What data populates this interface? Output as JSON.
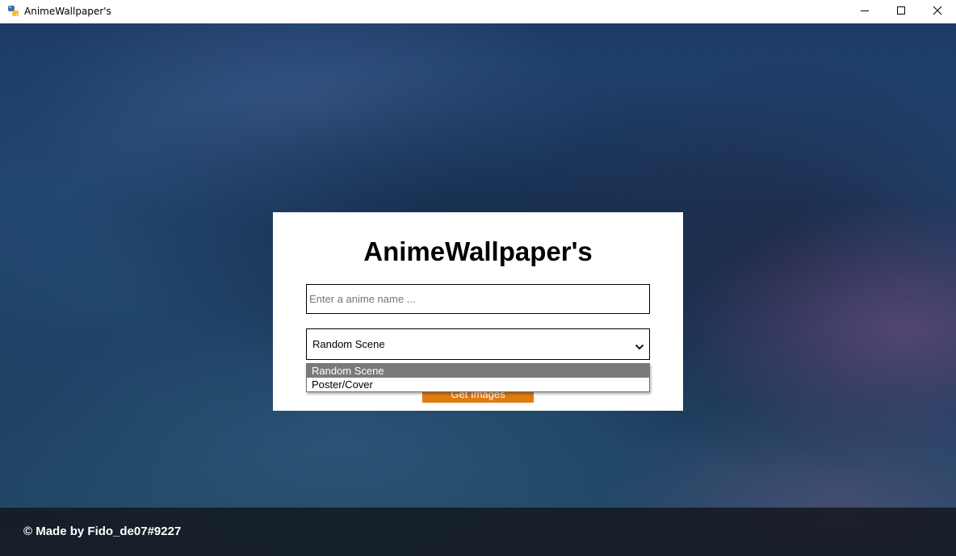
{
  "window": {
    "title": "AnimeWallpaper's",
    "icon": "python-icon",
    "controls": [
      "minimize-icon",
      "maximize-icon",
      "close-icon"
    ]
  },
  "card": {
    "title": "AnimeWallpaper's",
    "search": {
      "placeholder": "Enter a anime name ...",
      "value": ""
    },
    "type_select": {
      "selected": "Random Scene",
      "options": [
        "Random Scene",
        "Poster/Cover"
      ]
    },
    "submit_label": "Get Images"
  },
  "footer": {
    "text": "© Made by Fido_de07#9227"
  },
  "colors": {
    "accent": "#e07b12",
    "footer_bg": "#14161c",
    "option_highlight": "#7a7a7a"
  }
}
